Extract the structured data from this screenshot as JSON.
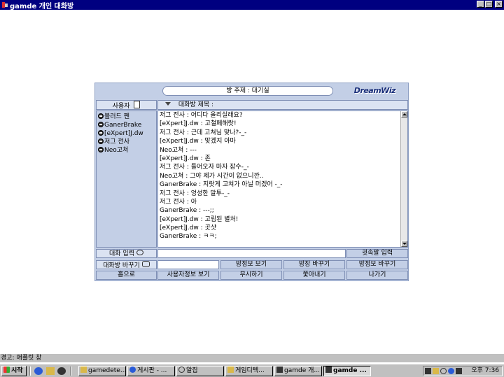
{
  "window": {
    "title": "gamde 개인 대화방",
    "min_glyph": "_",
    "max_glyph": "□",
    "close_glyph": "×"
  },
  "room": {
    "topic": "방 주제 : 대기실",
    "logo": "DreamWiz",
    "users_header": "사용자",
    "room_title_label": "대화방 제목 :"
  },
  "users": [
    {
      "name": "블러드 펜"
    },
    {
      "name": "GanerBrake"
    },
    {
      "name": "[eXpert]J.dw"
    },
    {
      "name": "저그 전사"
    },
    {
      "name": "Neo고쳐"
    }
  ],
  "messages": [
    "저그 전사 : 어디다 올리실래요?",
    "[eXpert]J.dw : 고철폐해랏!",
    "저그 전사 : 근데 고쳐님 맞나?-_-",
    "[eXpert]J.dw : 맞겠지 아마",
    "Neo고쳐 : ---",
    "[eXpert]J.dw : 존",
    "저그 전사 : 들어오자 마자 잠수-_-",
    "Neo고쳐 : 그야 제가 시간이 없으니깐..",
    "GanerBrake : 지랏게 고쳐가 아닐 머겠어 -_-",
    "저그 전사 : 엉성한 말투-_-",
    "저그 전사 : 아",
    "GanerBrake : ---;;",
    "[eXpert]J.dw : 고립된 별처!",
    "[eXpert]J.dw : 곳샷",
    "GanerBrake : ㅋㅋ;"
  ],
  "controls": {
    "chat_input_label": "대화 입력",
    "chat_input_value": "",
    "quick_input": "귓속말 입력",
    "change_room": "대화방 바꾸기",
    "room_name_value": "",
    "room_info": "방정보 보기",
    "change_master": "방장 바꾸기",
    "room_info2": "방정보 바꾸기",
    "home": "홈으로",
    "user_info": "사용자정보 보기",
    "ignore": "무시하기",
    "kick": "쫓아내기",
    "exit": "나가기"
  },
  "statusbar": {
    "text": "경고: 애플릿 창"
  },
  "taskbar": {
    "start": "시작",
    "tasks": [
      {
        "label": "gamedete..."
      },
      {
        "label": "게시판 - ..."
      },
      {
        "label": "알집"
      },
      {
        "label": "게임디텍..."
      },
      {
        "label": "gamde 개..."
      },
      {
        "label": "gamde ..."
      }
    ],
    "clock": "오후 7:36"
  },
  "colors": {
    "titlebar": "#000080",
    "panel": "#c3cfe6",
    "panel_border": "#7f8fb5",
    "logo": "#1a2f7a"
  }
}
